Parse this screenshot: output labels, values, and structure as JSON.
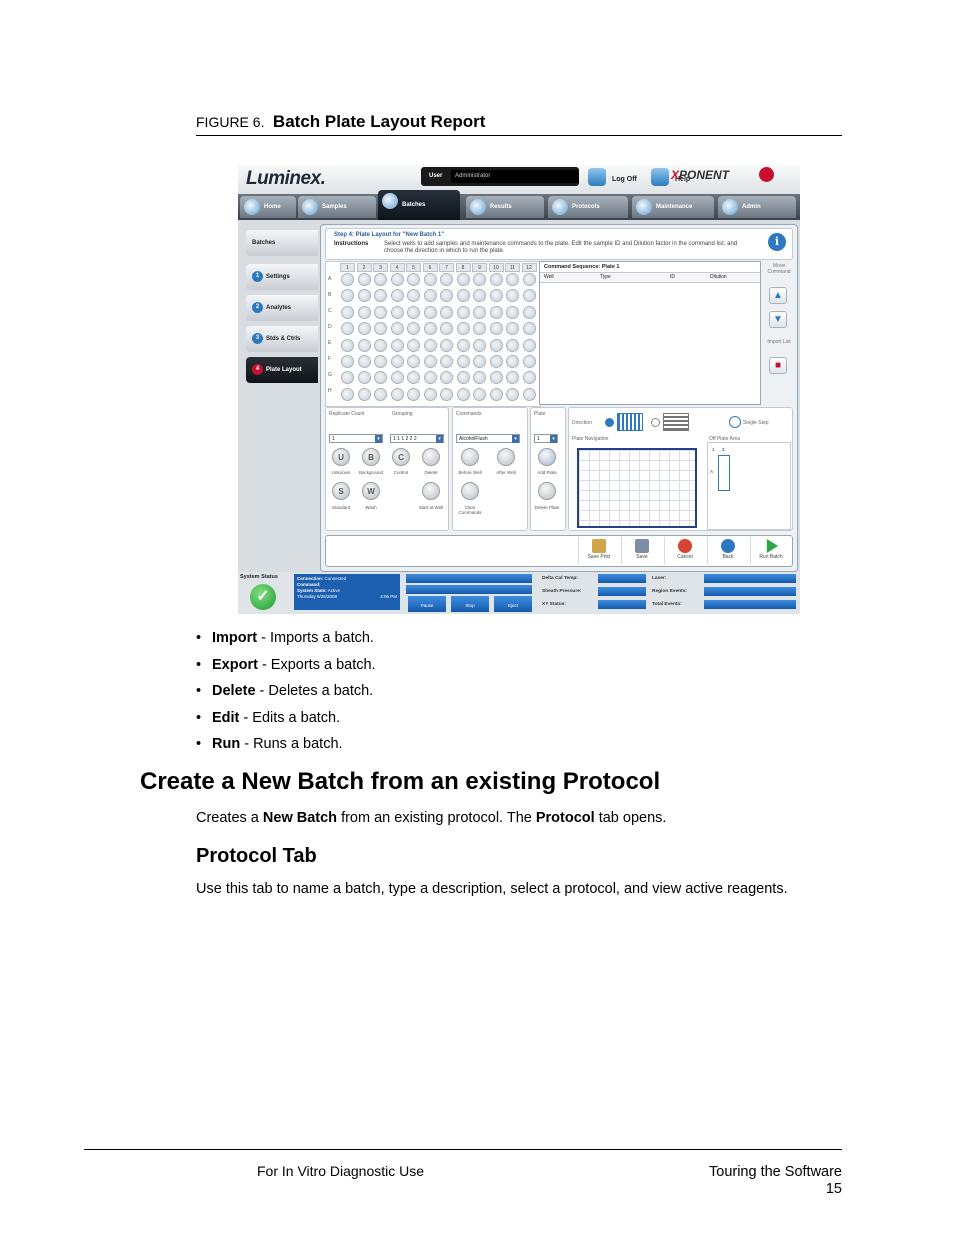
{
  "figure": {
    "number": "FIGURE 6.",
    "title": "Batch Plate Layout Report"
  },
  "screenshot": {
    "logo": "Luminex.",
    "user_label": "User",
    "user_value": "Administrator",
    "logoff": "Log Off",
    "help": "Help",
    "brand_prefix": "X",
    "brand": "PONENT",
    "tabs": [
      "Home",
      "Samples",
      "Batches",
      "Results",
      "Protocols",
      "Maintenance",
      "Admin"
    ],
    "side_items": [
      {
        "num": "",
        "label": "Batches"
      },
      {
        "num": "1",
        "label": "Settings"
      },
      {
        "num": "2",
        "label": "Analytes"
      },
      {
        "num": "3",
        "label": "Stds & Ctrls"
      },
      {
        "num": "4",
        "label": "Plate Layout"
      }
    ],
    "step_title": "Step 4: Plate Layout for \"New Batch 1\"",
    "instructions_label": "Instructions",
    "instructions_text": "Select wells to add samples and maintenance commands to the plate. Edit the sample ID and Dilution factor in the command list, and choose the direction in which to run the plate.",
    "info_icon": "i",
    "columns": [
      "1",
      "2",
      "3",
      "4",
      "5",
      "6",
      "7",
      "8",
      "9",
      "10",
      "11",
      "12"
    ],
    "rows": [
      "A",
      "B",
      "C",
      "D",
      "E",
      "F",
      "G",
      "H"
    ],
    "command_sequence_title": "Command Sequence: Plate 1",
    "command_headers": [
      "Well",
      "Type",
      "ID",
      "Dilution"
    ],
    "move_command": "Move Command",
    "import_list": "Import List",
    "replicate_count_label": "Replicate Count",
    "replicate_count_value": "1",
    "grouping_label": "Grouping",
    "grouping_value": "1 1 1 2 2 2",
    "commands_label": "Commands",
    "commands_value": "AlcoholFlush",
    "plate_label": "Plate",
    "plate_value": "1",
    "well_types": [
      {
        "letter": "U",
        "label": "Unknown"
      },
      {
        "letter": "B",
        "label": "Background"
      },
      {
        "letter": "C",
        "label": "Control"
      },
      {
        "letter": "",
        "label": "Delete"
      },
      {
        "letter": "S",
        "label": "Standard"
      },
      {
        "letter": "W",
        "label": "Wash"
      },
      {
        "letter": "",
        "label": "Start at Well"
      }
    ],
    "cmd_buttons": [
      "Before Well",
      "After Well",
      "Clear Commands"
    ],
    "plate_buttons": [
      "Add Plate",
      "Delete Plate"
    ],
    "direction_label": "Direction",
    "single_step": "Single Step",
    "plate_navigation": "Plate Navigation",
    "off_plate_area": "Off Plate Area",
    "off_plate_cols": [
      "1",
      "2"
    ],
    "off_plate_row": "A",
    "bottom_buttons": [
      "Save Prtcl",
      "Save",
      "Cancel",
      "Back",
      "Run Batch"
    ],
    "system_status": "System Status",
    "status_lines": [
      {
        "k": "Connection:",
        "v": "Connected"
      },
      {
        "k": "Command:",
        "v": ""
      },
      {
        "k": "System State:",
        "v": "Active"
      },
      {
        "k": "Thursday 6/26/2008",
        "v": "4:06 PM"
      }
    ],
    "run_buttons": [
      "Pause",
      "Stop",
      "Eject"
    ],
    "metrics_left": [
      "Delta Cal Temp:",
      "Sheath Pressure:",
      "XY Status:"
    ],
    "metrics_right": [
      "Laser:",
      "Region Events:",
      "Total Events:"
    ],
    "colors": {
      "accent": "#2e78c0",
      "active_tab": "#0e141a",
      "brand_red": "#c8102e",
      "status_green": "#1f9a34"
    }
  },
  "bullets": [
    {
      "term": "Import",
      "desc": " - Imports a batch."
    },
    {
      "term": "Export",
      "desc": " - Exports a batch."
    },
    {
      "term": "Delete",
      "desc": " - Deletes a batch."
    },
    {
      "term": "Edit",
      "desc": " - Edits a batch."
    },
    {
      "term": "Run",
      "desc": " - Runs a batch."
    }
  ],
  "heading1": "Create a New Batch from an existing Protocol",
  "para1": {
    "a": "Creates a ",
    "b": "New Batch",
    "c": " from an existing protocol. The ",
    "d": "Protocol",
    "e": " tab opens."
  },
  "heading2": "Protocol Tab",
  "para2": "Use this tab to name a batch, type a description, select a protocol, and view active reagents.",
  "footer": {
    "left": "For In Vitro Diagnostic Use",
    "right": "Touring the Software",
    "page": "15"
  }
}
